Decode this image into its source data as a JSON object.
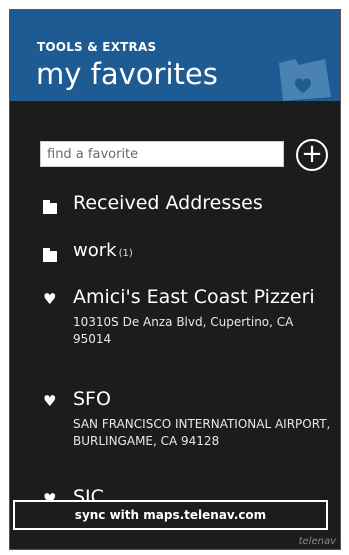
{
  "header": {
    "section": "TOOLS & EXTRAS",
    "title": "my favorites"
  },
  "search": {
    "placeholder": "find a favorite",
    "add_symbol": "+"
  },
  "items": [
    {
      "type": "folder",
      "name": "Received Addresses",
      "count": ""
    },
    {
      "type": "folder",
      "name": "work",
      "count": "(1)"
    },
    {
      "type": "favorite",
      "name": "Amici's East Coast Pizzeri",
      "address": "10310S De Anza Blvd, Cupertino, CA 95014"
    },
    {
      "type": "favorite",
      "name": "SFO",
      "address": "SAN FRANCISCO INTERNATIONAL AIRPORT, BURLINGAME, CA 94128"
    },
    {
      "type": "favorite",
      "name": "SJC",
      "address": ""
    }
  ],
  "footer": {
    "sync_label": "sync with maps.telenav.com",
    "brand": "telenav"
  },
  "colors": {
    "header_bg": "#1f5b93",
    "screen_bg": "#1c1c1c",
    "text": "#ffffff"
  }
}
